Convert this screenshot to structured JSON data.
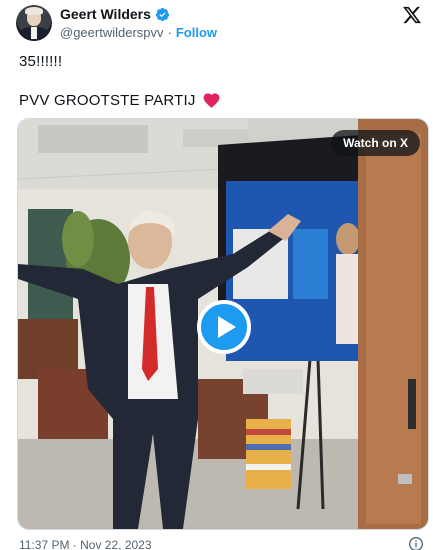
{
  "author": {
    "name": "Geert Wilders",
    "handle": "@geertwilderspvv",
    "separator": "·",
    "follow_label": "Follow",
    "verified_icon": "verified-badge-icon"
  },
  "tweet": {
    "line1": "35!!!!!!",
    "line2": "PVV GROOTSTE PARTIJ",
    "emoji": "red-heart-icon"
  },
  "media": {
    "watch_label": "Watch on X",
    "play_icon": "play-icon"
  },
  "footer": {
    "timestamp": "11:37 PM · Nov 22, 2023"
  },
  "colors": {
    "accent": "#1d9bf0",
    "heart": "#e0245e",
    "text": "#0f1419",
    "muted": "#536471"
  }
}
